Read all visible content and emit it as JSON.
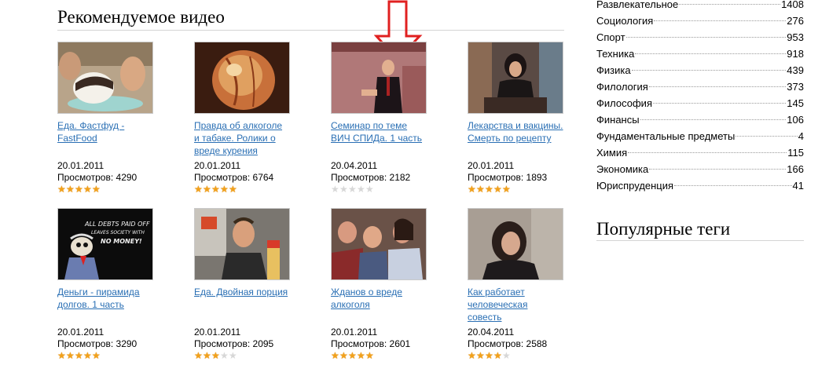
{
  "section": {
    "title": "Рекомендуемое видео"
  },
  "videos": [
    {
      "title": "Еда. Фастфуд - FastFood",
      "date": "20.01.2011",
      "views_label": "Просмотров: 4290",
      "rating": 5
    },
    {
      "title": "Правда об алкоголе и табаке. Ролики о вреде курения",
      "date": "20.01.2011",
      "views_label": "Просмотров: 6764",
      "rating": 5
    },
    {
      "title": "Семинар по теме ВИЧ СПИДа. 1 часть",
      "date": "20.04.2011",
      "views_label": "Просмотров: 2182",
      "rating": 0
    },
    {
      "title": "Лекарства и вакцины. Смерть по рецепту",
      "date": "20.01.2011",
      "views_label": "Просмотров: 1893",
      "rating": 5
    },
    {
      "title": "Деньги - пирамида долгов. 1 часть",
      "date": "20.01.2011",
      "views_label": "Просмотров: 3290",
      "rating": 5
    },
    {
      "title": "Еда. Двойная порция",
      "date": "20.01.2011",
      "views_label": "Просмотров: 2095",
      "rating": 3
    },
    {
      "title": "Жданов о вреде алкоголя",
      "date": "20.01.2011",
      "views_label": "Просмотров: 2601",
      "rating": 5
    },
    {
      "title": "Как работает человеческая совесть",
      "date": "20.04.2011",
      "views_label": "Просмотров: 2588",
      "rating": 4
    }
  ],
  "thumb4_caption": [
    "ALL DEBTS PAID OFF",
    "LEAVES SOCIETY WITH",
    "NO MONEY!"
  ],
  "categories": [
    {
      "name": "Развлекательное",
      "count": "1408"
    },
    {
      "name": "Социология",
      "count": "276"
    },
    {
      "name": "Спорт",
      "count": "953"
    },
    {
      "name": "Техника",
      "count": "918"
    },
    {
      "name": "Физика",
      "count": "439"
    },
    {
      "name": "Филология",
      "count": "373"
    },
    {
      "name": "Философия",
      "count": "145"
    },
    {
      "name": "Финансы",
      "count": "106"
    },
    {
      "name": "Фундаментальные предметы",
      "count": "4"
    },
    {
      "name": "Химия",
      "count": "115"
    },
    {
      "name": "Экономика",
      "count": "166"
    },
    {
      "name": "Юриспруденция",
      "count": "41"
    }
  ],
  "tags": {
    "title": "Популярные теги"
  },
  "colors": {
    "link": "#2a6fb4",
    "star": "#f2a11a",
    "arrow": "#e02020"
  },
  "icons": {
    "star": "star-icon",
    "arrow": "down-arrow-icon"
  }
}
